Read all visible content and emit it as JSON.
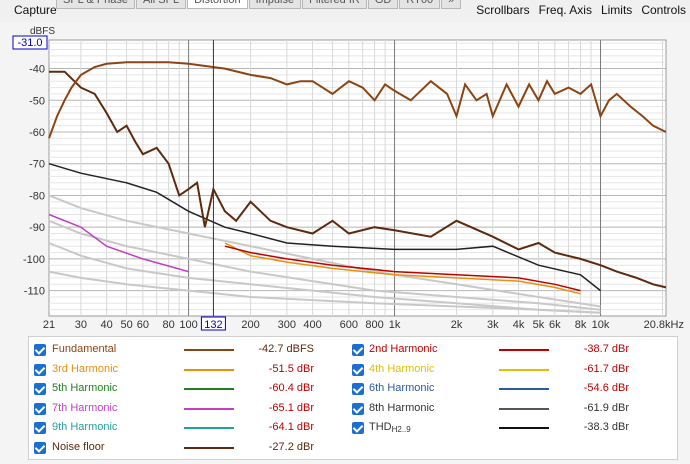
{
  "app": {
    "capture_label": "Capture",
    "tabs": [
      "SPL & Phase",
      "All SPL",
      "Distortion",
      "Impulse",
      "Filtered IR",
      "GD",
      "RT60",
      "»"
    ],
    "menu": [
      "Scrollbars",
      "Freq. Axis",
      "Limits",
      "Controls"
    ]
  },
  "axes": {
    "y_unit": "dBFS",
    "y_cursor_value": "-31.0",
    "x_cursor_value": "132",
    "y_ticks": [
      "-40",
      "-50",
      "-60",
      "-70",
      "-80",
      "-90",
      "-100",
      "-110"
    ],
    "x_ticks": [
      "21",
      "30",
      "40",
      "50",
      "60",
      "80",
      "100",
      "200",
      "300",
      "400",
      "600",
      "800",
      "1k",
      "2k",
      "3k",
      "4k",
      "5k",
      "6k",
      "8k",
      "10k",
      "20.8kHz"
    ]
  },
  "chart_data": {
    "type": "line",
    "xscale": "log",
    "xlim": [
      21,
      20800
    ],
    "ylim": [
      -118,
      -31
    ],
    "ylabel": "dBFS",
    "series": [
      {
        "name": "Fundamental",
        "color": "#8b4513",
        "x": [
          21,
          23,
          25,
          27,
          30,
          35,
          40,
          50,
          60,
          80,
          100,
          150,
          200,
          250,
          300,
          350,
          400,
          500,
          600,
          700,
          800,
          900,
          1000,
          1200,
          1500,
          1800,
          2000,
          2200,
          2500,
          2800,
          3000,
          3500,
          4000,
          4500,
          5000,
          5500,
          6000,
          7000,
          8000,
          9000,
          10000,
          11000,
          12000,
          14000,
          16000,
          18000,
          20800
        ],
        "y": [
          -62,
          -55,
          -50,
          -46,
          -42,
          -39.5,
          -38.5,
          -38,
          -38,
          -38,
          -38.5,
          -40,
          -42,
          -43,
          -45,
          -44,
          -44,
          -48,
          -44,
          -46,
          -50,
          -45,
          -47,
          -50,
          -44,
          -48,
          -55,
          -45,
          -50,
          -48,
          -55,
          -45,
          -52,
          -45,
          -50,
          -44,
          -48,
          -46,
          -48,
          -45,
          -55,
          -50,
          -48,
          -52,
          -55,
          -58,
          -60
        ]
      },
      {
        "name": "Noise floor",
        "color": "#5c2a0e",
        "x": [
          21,
          25,
          30,
          35,
          40,
          45,
          50,
          55,
          60,
          70,
          80,
          90,
          100,
          110,
          120,
          132,
          150,
          170,
          200,
          250,
          300,
          400,
          500,
          600,
          800,
          1000,
          1500,
          2000,
          3000,
          4000,
          5000,
          6000,
          8000,
          10000,
          12000,
          15000,
          18000,
          20800
        ],
        "y": [
          -41,
          -41,
          -46,
          -48,
          -54,
          -60,
          -58,
          -63,
          -67,
          -65,
          -70,
          -80,
          -78,
          -76,
          -90,
          -78,
          -85,
          -88,
          -82,
          -88,
          -90,
          -92,
          -88,
          -92,
          -90,
          -91,
          -93,
          -88,
          -93,
          -97,
          -95,
          -98,
          -100,
          -102,
          -104,
          -106,
          -108,
          -109
        ]
      },
      {
        "name": "THD H2..9",
        "color": "#222222",
        "x": [
          21,
          30,
          50,
          70,
          100,
          150,
          200,
          300,
          500,
          1000,
          2000,
          3000,
          5000,
          8000,
          10000
        ],
        "y": [
          -70,
          -73,
          -76,
          -79,
          -85,
          -90,
          -92,
          -95,
          -96,
          -97,
          -97,
          -96,
          -102,
          -105,
          -110
        ]
      },
      {
        "name": "2nd Harmonic",
        "color": "#c00000",
        "x": [
          150,
          200,
          300,
          500,
          1000,
          2000,
          4000,
          6000,
          8000
        ],
        "y": [
          -96,
          -98,
          -100,
          -102,
          -104,
          -105,
          -106,
          -108,
          -110
        ]
      },
      {
        "name": "3rd Harmonic",
        "color": "#e8900c",
        "x": [
          150,
          200,
          300,
          500,
          1000,
          2000,
          4000,
          6000,
          8000
        ],
        "y": [
          -95,
          -99,
          -101,
          -103,
          -105,
          -106,
          -107,
          -109,
          -111
        ]
      },
      {
        "name": "7th Harmonic",
        "color": "#c040c0",
        "x": [
          21,
          30,
          40,
          60,
          100
        ],
        "y": [
          -86,
          -90,
          -96,
          -100,
          -104
        ]
      }
    ]
  },
  "legend": [
    {
      "name": "Fundamental",
      "color": "#8b4513",
      "value": "-42.7 dBFS"
    },
    {
      "name": "2nd Harmonic",
      "color": "#c00000",
      "value": "-38.7 dBr"
    },
    {
      "name": "3rd Harmonic",
      "color": "#e8900c",
      "value": "-51.5 dBr"
    },
    {
      "name": "4th Harmonic",
      "color": "#e0c000",
      "value": "-61.7 dBr"
    },
    {
      "name": "5th Harmonic",
      "color": "#208020",
      "value": "-60.4 dBr"
    },
    {
      "name": "6th Harmonic",
      "color": "#2a5aa0",
      "value": "-54.6 dBr"
    },
    {
      "name": "7th Harmonic",
      "color": "#c040c0",
      "value": "-65.1 dBr"
    },
    {
      "name": "8th Harmonic",
      "color": "#555555",
      "value": "-61.9 dBr"
    },
    {
      "name": "9th Harmonic",
      "color": "#20a0a0",
      "value": "-64.1 dBr"
    },
    {
      "name": "THD",
      "sub": "H2..9",
      "color": "#111111",
      "value": "-38.3 dBr"
    },
    {
      "name": "Noise floor",
      "color": "#5c2a0e",
      "value": "-27.2 dBr"
    }
  ]
}
